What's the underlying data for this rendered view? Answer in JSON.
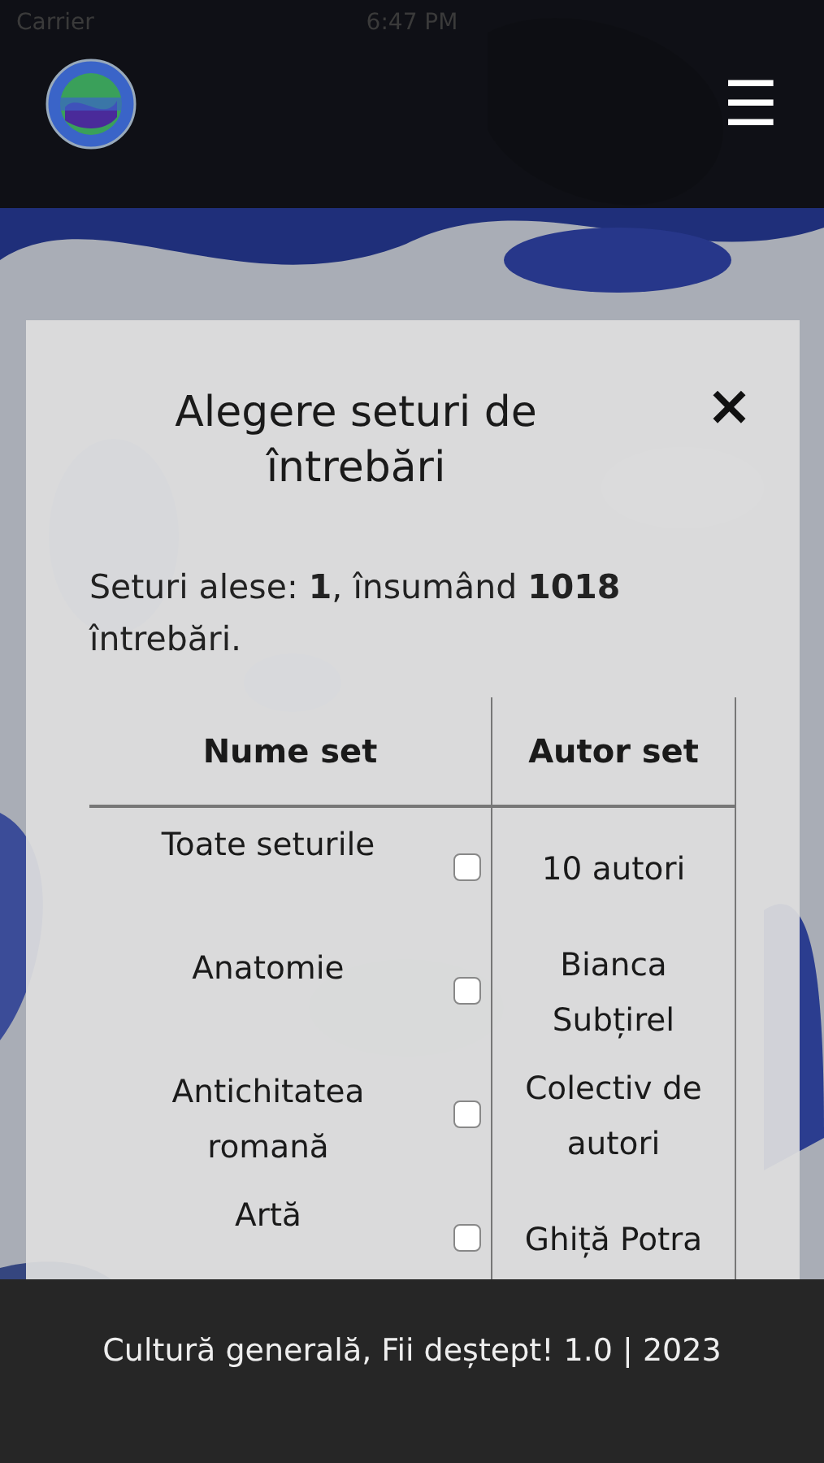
{
  "status_bar": {
    "carrier": "Carrier",
    "time": "6:47 PM"
  },
  "header": {
    "menu_icon": "☰"
  },
  "dialog": {
    "title": "Alegere seturi de întrebări",
    "close": "×",
    "summary": "Seturi alese: **1**, însumând **1018** întrebări.",
    "table": {
      "columns": [
        "Nume set",
        "Autor set"
      ],
      "rows": [
        {
          "name": "Toate seturile",
          "checked": false,
          "author": "10 autori"
        },
        {
          "name": "Anatomie",
          "checked": false,
          "author": "Bianca Subțirel"
        },
        {
          "name": "Antichitatea romană",
          "checked": false,
          "author": "Colectiv de autori"
        },
        {
          "name": "Artă",
          "checked": false,
          "author": "Ghiță Potra"
        }
      ]
    }
  },
  "footer": {
    "text": "Cultură generală, Fii deștept! 1.0 | 2023"
  }
}
